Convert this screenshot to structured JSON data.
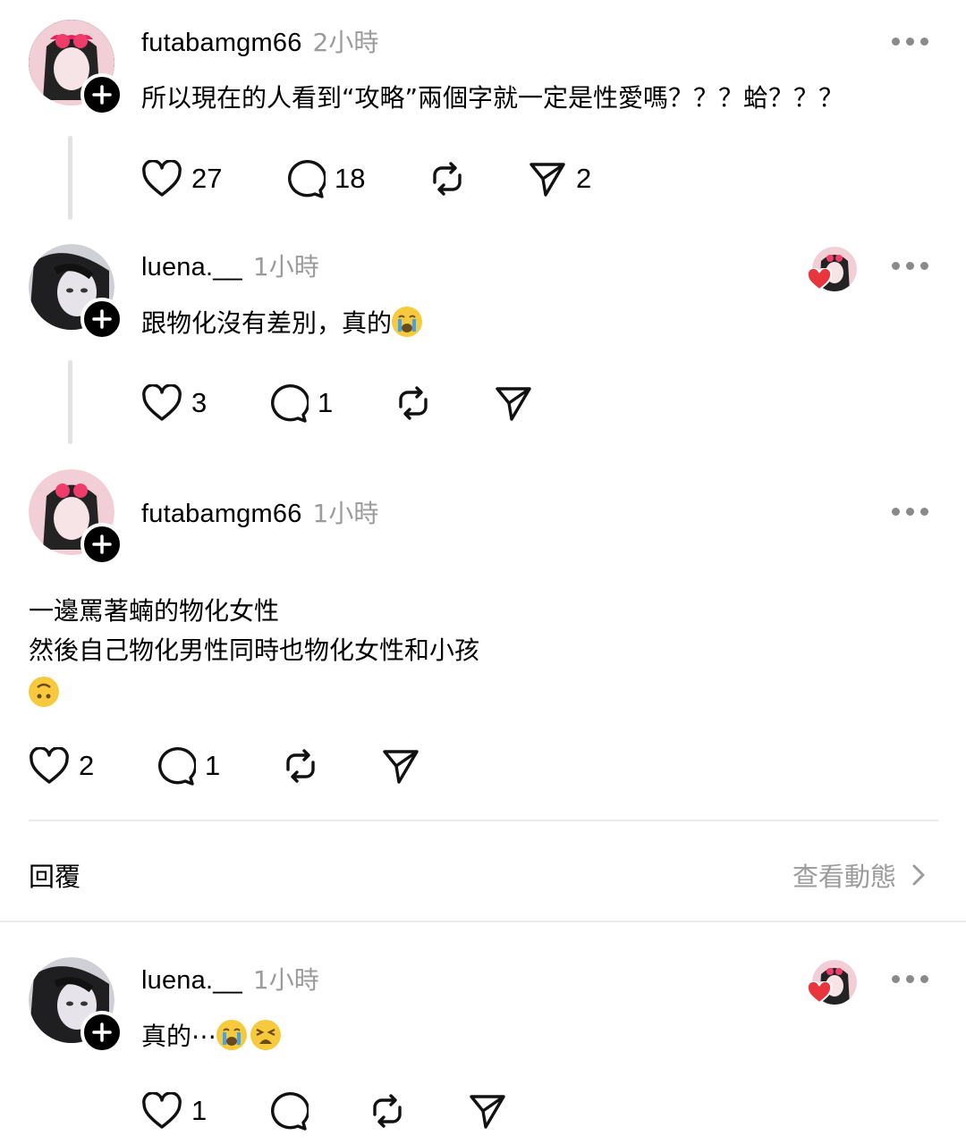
{
  "posts": [
    {
      "username": "futabamgm66",
      "time": "2小時",
      "text": "所以現在的人看到“攻略”兩個字就一定是性愛嗎？？？蛤？？？",
      "likes": "27",
      "comments": "18",
      "shares": "2"
    },
    {
      "username": "luena.__",
      "time": "1小時",
      "text": "跟物化沒有差別，真的",
      "likes": "3",
      "comments": "1"
    },
    {
      "username": "futabamgm66",
      "time": "1小時",
      "text_lines": [
        "一邊罵著蝻的物化女性",
        "然後自己物化男性同時也物化女性和小孩"
      ],
      "likes": "2",
      "comments": "1"
    },
    {
      "username": "luena.__",
      "time": "1小時",
      "text": "真的⋯",
      "likes": "1"
    }
  ],
  "replies_bar": {
    "label": "回覆",
    "view_activity": "查看動態"
  },
  "icons": [
    "heart-icon",
    "comment-icon",
    "repost-icon",
    "share-icon",
    "more-icon",
    "follow-plus-icon",
    "chevron-right-icon"
  ],
  "colors": {
    "text": "#000000",
    "muted": "#9b9b9b",
    "like_red": "#e8353e"
  }
}
